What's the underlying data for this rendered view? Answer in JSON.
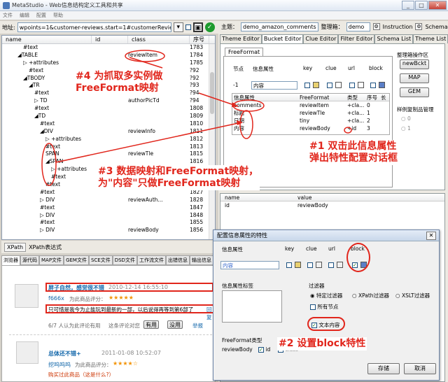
{
  "app": {
    "title": "MetaStudio - Web信息结构定义工具和共享",
    "menu": [
      "文件",
      "编辑",
      "配置",
      "帮助"
    ],
    "window_buttons": [
      "_",
      "□",
      "✕"
    ]
  },
  "address": {
    "label": "地址:",
    "value": "wpoints=1&customer-reviews.start=1#customerReviews"
  },
  "tree": {
    "headers": [
      "name",
      "id",
      "class",
      "序号"
    ],
    "rows": [
      {
        "name": "#text",
        "id": "",
        "cls": "",
        "seq": "1783",
        "indent": 30
      },
      {
        "name": "◢TABLE",
        "id": "",
        "cls": "reviewItem",
        "seq": "1784",
        "indent": 22
      },
      {
        "name": "▷ +attributes",
        "id": "",
        "cls": "",
        "seq": "1785",
        "indent": 30
      },
      {
        "name": "#text",
        "id": "",
        "cls": "",
        "seq": "?92",
        "indent": 38
      },
      {
        "name": "◢TBODY",
        "id": "",
        "cls": "",
        "seq": "?92",
        "indent": 30
      },
      {
        "name": "◢TR",
        "id": "",
        "cls": "",
        "seq": "?93",
        "indent": 38
      },
      {
        "name": "#text",
        "id": "",
        "cls": "",
        "seq": "?94",
        "indent": 46
      },
      {
        "name": "▷ TD",
        "id": "",
        "cls": "authorPicTd",
        "seq": "?94",
        "indent": 46
      },
      {
        "name": "#text",
        "id": "",
        "cls": "",
        "seq": "1808",
        "indent": 46
      },
      {
        "name": "◢TD",
        "id": "",
        "cls": "",
        "seq": "1809",
        "indent": 46
      },
      {
        "name": "#text",
        "id": "",
        "cls": "",
        "seq": "1810",
        "indent": 54
      },
      {
        "name": "◢DIV",
        "id": "",
        "cls": "reviewInfo",
        "seq": "1811",
        "indent": 54
      },
      {
        "name": "▷ +attributes",
        "id": "",
        "cls": "",
        "seq": "1812",
        "indent": 62
      },
      {
        "name": "#text",
        "id": "",
        "cls": "",
        "seq": "1813",
        "indent": 62
      },
      {
        "name": "SPAN",
        "id": "",
        "cls": "reviewTle",
        "seq": "1815",
        "indent": 62
      },
      {
        "name": "◢SPAN",
        "id": "",
        "cls": "",
        "seq": "1816",
        "indent": 62
      },
      {
        "name": "▷ +attributes",
        "id": "",
        "cls": "",
        "seq": "1817",
        "indent": 70
      },
      {
        "name": "#text",
        "id": "",
        "cls": "",
        "seq": "1818",
        "indent": 70
      },
      {
        "name": "#text",
        "id": "",
        "cls": "",
        "seq": "1826",
        "indent": 62
      },
      {
        "name": "#text",
        "id": "",
        "cls": "",
        "seq": "1827",
        "indent": 54
      },
      {
        "name": "▷ DIV",
        "id": "",
        "cls": "reviewAuth...",
        "seq": "1828",
        "indent": 54
      },
      {
        "name": "#text",
        "id": "",
        "cls": "",
        "seq": "1847",
        "indent": 54
      },
      {
        "name": "▷ DIV",
        "id": "",
        "cls": "",
        "seq": "1848",
        "indent": 54
      },
      {
        "name": "#text",
        "id": "",
        "cls": "",
        "seq": "1855",
        "indent": 54
      },
      {
        "name": "▷ DIV",
        "id": "",
        "cls": "reviewBody",
        "seq": "1856",
        "indent": 54
      }
    ]
  },
  "xpath": {
    "button": "XPath",
    "label": "XPath表达式"
  },
  "browser": {
    "tabs": [
      "浏览器",
      "源代码",
      "MAP文件",
      "GEM文件",
      "SCE文件",
      "DSD文件",
      "工作流文件",
      "出错信息",
      "输出信息"
    ],
    "r1_title": "屏子自然，感觉很不错",
    "r1_time": "2010-12-14 16:55:10",
    "r1_user": "f666x",
    "r1_rating": "为此商品评分：",
    "r1_stars": "★★★★★",
    "r1_body": "只可惜是我今为止能玩到最新的一部，以后说得再等到第6部了",
    "r1_reply": "回复",
    "r1_helpful": "6/7 人认为此评论有用",
    "r1_ask": "这条评论对您",
    "r1_yes": "有用",
    "r1_no": "没用",
    "r1_report": "举报",
    "r2_title": "总体还不错+",
    "r2_time": "2011-01-08 10:52:07",
    "r2_user": "挖呜呜呜",
    "r2_rating": "为此商品评分：",
    "r2_stars": "★★★★☆",
    "r2_body": "购买过此商品（这是什么?）"
  },
  "right": {
    "topic_label": "主题：",
    "topic_value": "demo_amazon_comments",
    "org_label": "整理箱：",
    "org_value": "demo",
    "instruction": "Instruction",
    "schema": "Schema",
    "tabs": [
      "Theme Editor",
      "Bucket Editor",
      "Clue Editor",
      "Filter Editor",
      "Schema List",
      "Theme List"
    ],
    "ff_tab": "FreeFormat",
    "col_headers": [
      "节点",
      "信息属性",
      "key",
      "clue",
      "url",
      "block"
    ],
    "row_node": "-1",
    "row_attr": "内容",
    "grid_headers": [
      "信息属性",
      "FreeFormat",
      "类型",
      "序号",
      "长"
    ],
    "grid_rows": [
      {
        "attr": "comments",
        "ff": "reviewItem",
        "type": "+cla...",
        "seq": "0"
      },
      {
        "attr": "标题",
        "ff": "reviewTle",
        "type": "+cla...",
        "seq": "1"
      },
      {
        "attr": "日期",
        "ff": "tiny",
        "type": "+cla...",
        "seq": "2"
      },
      {
        "attr": "内容",
        "ff": "reviewBody",
        "type": "+id",
        "seq": "3"
      }
    ],
    "side_title": "整理箱操作区",
    "side_btns": [
      "newBckt",
      "MAP",
      "GEM"
    ],
    "sample_title": "样例复制品管理",
    "sample_opts": [
      "0",
      "1"
    ],
    "prop_headers": [
      "name",
      "value"
    ],
    "prop_row": {
      "name": "id",
      "value": "reviewBody"
    }
  },
  "dialog": {
    "title": "配置信息属性的特性",
    "close": "✕",
    "cols": [
      "信息属性",
      "key",
      "clue",
      "url",
      "block"
    ],
    "attr_value": "内容",
    "label_section": "信息属性标签",
    "filter_title": "过滤器",
    "filter_opts": [
      "特定过滤器",
      "XPath过滤器",
      "XSLT过滤器"
    ],
    "all_nodes": "所有节点",
    "text_content": "文本内容",
    "ff_type": "FreeFormat类型",
    "ff_name": "reviewBody",
    "ff_id": "id",
    "ff_class": "class",
    "save": "存储",
    "cancel": "取消"
  },
  "annotations": {
    "a4_line1": "#4 为抓取多实例做",
    "a4_line2": "FreeFormat映射",
    "a1_line1": "#1 双击此信息属性",
    "a1_line2": "弹出特性配置对话框",
    "a3_line1": "#3 数据映射和FreeFormat映射，",
    "a3_line2": "为\"内容\"只做FreeFormat映射",
    "a2": "#2 设置block特性"
  },
  "colors": {
    "annotation": "#e1261c",
    "accent": "#1e9b2e"
  }
}
